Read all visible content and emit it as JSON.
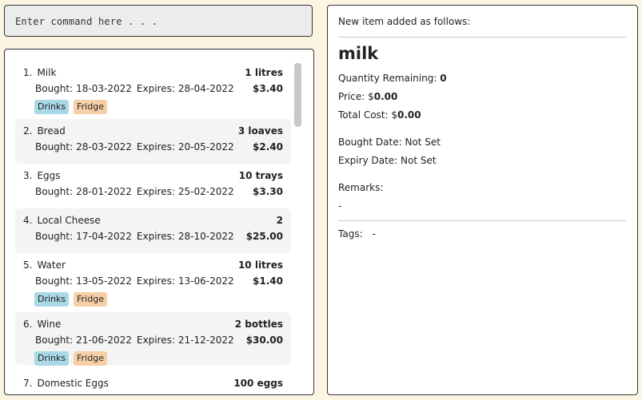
{
  "command_box": {
    "placeholder": "Enter command here . . ."
  },
  "items": [
    {
      "index": "1.",
      "name": "Milk",
      "bought_label": "Bought:",
      "bought": "18-03-2022",
      "expires_label": "Expires:",
      "expires": "28-04-2022",
      "quantity": "1 litres",
      "price": "$3.40",
      "tags": [
        "Drinks",
        "Fridge"
      ]
    },
    {
      "index": "2.",
      "name": "Bread",
      "bought_label": "Bought:",
      "bought": "28-03-2022",
      "expires_label": "Expires:",
      "expires": "20-05-2022",
      "quantity": "3 loaves",
      "price": "$2.40",
      "tags": []
    },
    {
      "index": "3.",
      "name": "Eggs",
      "bought_label": "Bought:",
      "bought": "28-01-2022",
      "expires_label": "Expires:",
      "expires": "25-02-2022",
      "quantity": "10 trays",
      "price": "$3.30",
      "tags": []
    },
    {
      "index": "4.",
      "name": "Local Cheese",
      "bought_label": "Bought:",
      "bought": "17-04-2022",
      "expires_label": "Expires:",
      "expires": "28-10-2022",
      "quantity": "2",
      "price": "$25.00",
      "tags": []
    },
    {
      "index": "5.",
      "name": "Water",
      "bought_label": "Bought:",
      "bought": "13-05-2022",
      "expires_label": "Expires:",
      "expires": "13-06-2022",
      "quantity": "10 litres",
      "price": "$1.40",
      "tags": [
        "Drinks",
        "Fridge"
      ]
    },
    {
      "index": "6.",
      "name": "Wine",
      "bought_label": "Bought:",
      "bought": "21-06-2022",
      "expires_label": "Expires:",
      "expires": "21-12-2022",
      "quantity": "2 bottles",
      "price": "$30.00",
      "tags": [
        "Drinks",
        "Fridge"
      ]
    },
    {
      "index": "7.",
      "name": "Domestic Eggs",
      "bought_label": "",
      "bought": "",
      "expires_label": "",
      "expires": "",
      "quantity": "100 eggs",
      "price": "",
      "tags": []
    }
  ],
  "detail": {
    "header": "New item added as follows:",
    "name": "milk",
    "quantity_label": "Quantity Remaining:",
    "quantity_value": "0",
    "price_label": "Price: $",
    "price_value": "0.00",
    "total_label": "Total Cost: $",
    "total_value": "0.00",
    "bought_line": "Bought Date: Not Set",
    "expiry_line": "Expiry Date: Not Set",
    "remarks_label": "Remarks:",
    "remarks_value": "-",
    "tags_label": "Tags:",
    "tags_value": "-"
  },
  "colors": {
    "tag_drinks": "#a9d8e6",
    "tag_fridge": "#f6cfa6",
    "background": "#fdf5e3"
  }
}
